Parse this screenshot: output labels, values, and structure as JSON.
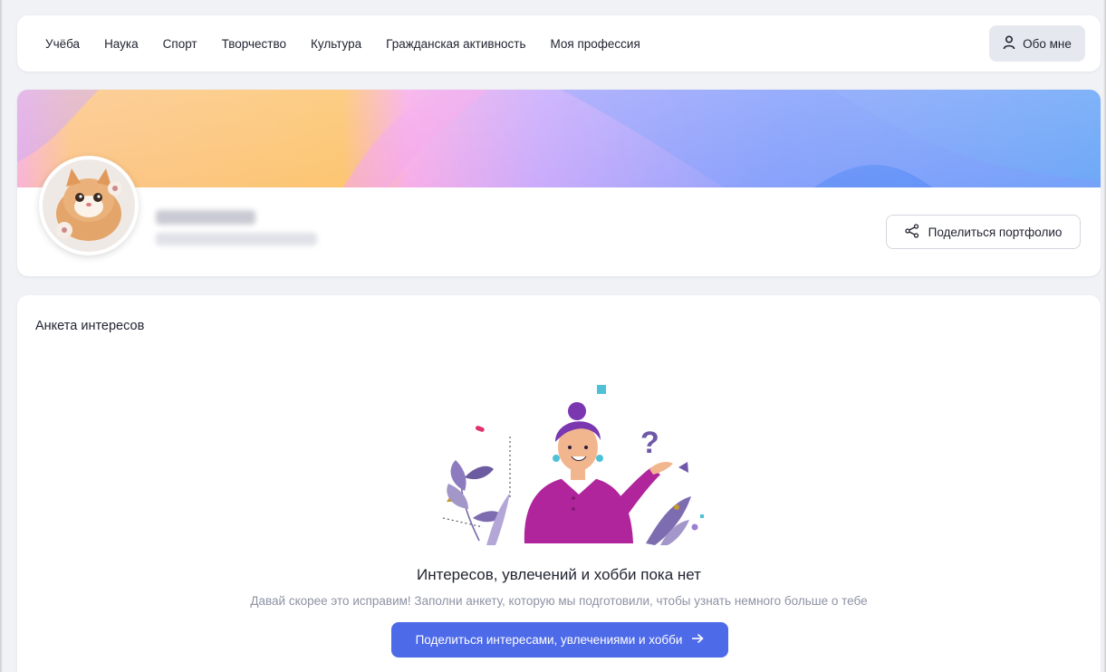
{
  "nav": {
    "items": [
      {
        "label": "Учёба"
      },
      {
        "label": "Наука"
      },
      {
        "label": "Спорт"
      },
      {
        "label": "Творчество"
      },
      {
        "label": "Культура"
      },
      {
        "label": "Гражданская активность"
      },
      {
        "label": "Моя профессия"
      }
    ],
    "about_label": "Обо мне",
    "about_icon": "user-icon"
  },
  "profile": {
    "avatar_icon": "kitten-avatar",
    "share_label": "Поделиться портфолио",
    "share_icon": "share-icon"
  },
  "interests": {
    "title": "Анкета интересов",
    "empty_title": "Интересов, увлечений и хобби пока нет",
    "empty_description": "Давай скорее это исправим! Заполни анкету, которую мы подготовили, чтобы узнать немного больше о тебе",
    "cta_label": "Поделиться интересами, увлечениями и хобби",
    "cta_icon": "arrow-right-icon"
  },
  "colors": {
    "primary": "#4d6ae8",
    "background": "#f1f2f6",
    "text": "#222431",
    "muted": "#8e92a4"
  }
}
